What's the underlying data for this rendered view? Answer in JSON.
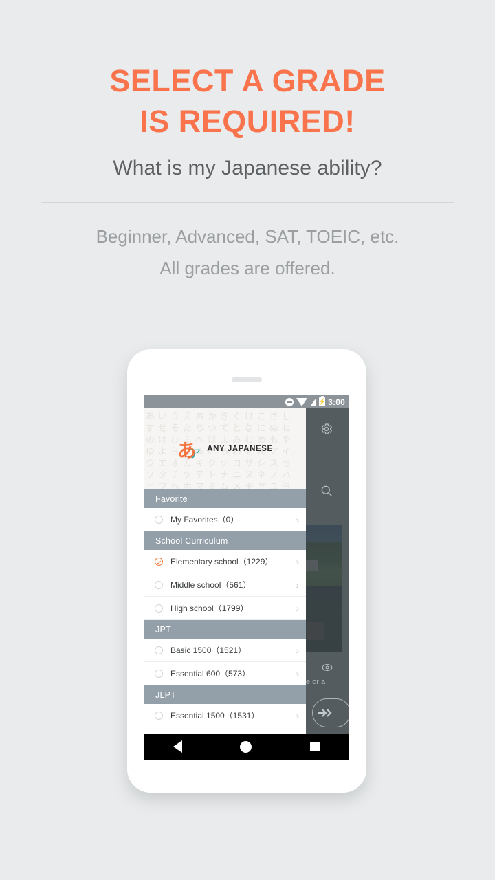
{
  "promo": {
    "title_line1": "SELECT A GRADE",
    "title_line2": "IS REQUIRED!",
    "subtitle": "What is my Japanese ability?",
    "note_line1": "Beginner, Advanced, SAT, TOEIC, etc.",
    "note_line2": "All grades are offered.",
    "accent_color": "#f9744c",
    "subtitle_color": "#5e6164",
    "note_color": "#9b9fa2",
    "background_color": "#e9ebec"
  },
  "phone": {
    "status_bar": {
      "time": "3:00",
      "icons": [
        "do-not-disturb-icon",
        "wifi-icon",
        "signal-icon",
        "battery-charging-icon"
      ]
    },
    "nav_bar": {
      "back": "back-nav-icon",
      "home": "home-nav-icon",
      "recents": "recents-nav-icon"
    }
  },
  "app": {
    "logo": {
      "mark_hiragana": "あ",
      "mark_katakana": "ア",
      "name": "ANY JAPANESE",
      "hiragana_color": "#f4733f",
      "katakana_color": "#17a5a5"
    },
    "watermark_text": "あいうえおかきくけこさしすせそたちつてとなにぬねのはひふへほまみむめもやゆよらりるれろわをんアイウエオカキクケコサシスセソタチツテトナニヌネノハヒフヘホマミムメモヤユヨラリルレロワヲン",
    "drawer": {
      "sections": [
        {
          "header": "Favorite",
          "items": [
            {
              "label": "My Favorites（0）",
              "selected": false
            }
          ]
        },
        {
          "header": "School Curriculum",
          "items": [
            {
              "label": "Elementary school（1229）",
              "selected": true
            },
            {
              "label": "Middle school（561）",
              "selected": false
            },
            {
              "label": "High school（1799）",
              "selected": false
            }
          ]
        },
        {
          "header": "JPT",
          "items": [
            {
              "label": "Basic 1500（1521）",
              "selected": false
            },
            {
              "label": "Essential 600（573）",
              "selected": false
            }
          ]
        },
        {
          "header": "JLPT",
          "items": [
            {
              "label": "Essential 1500（1531）",
              "selected": false
            }
          ]
        }
      ],
      "chevron": "›",
      "selected_color": "#ef7c3c",
      "section_header_color": "#939fa9"
    },
    "overlay": {
      "gear": "gear-icon",
      "search": "search-icon",
      "eye": "eye-icon",
      "clipped_text": "e or a",
      "next": "double-arrow-icon"
    }
  }
}
